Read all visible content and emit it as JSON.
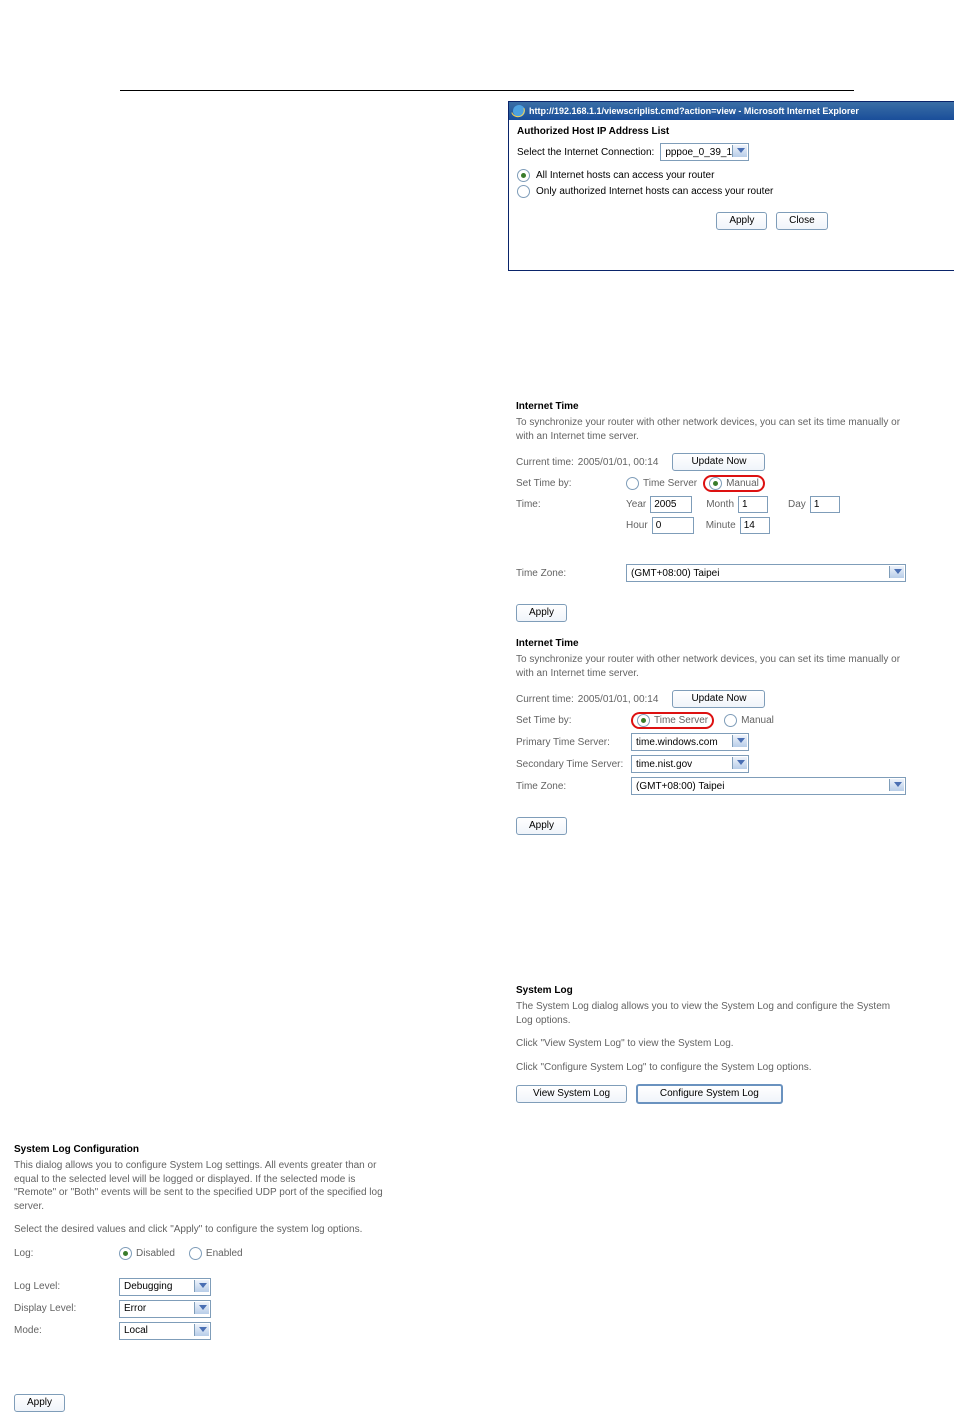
{
  "ie": {
    "title": "http://192.168.1.1/viewscriplist.cmd?action=view - Microsoft Internet Explorer",
    "heading": "Authorized Host IP Address List",
    "select_label": "Select the Internet Connection:",
    "select_value": "pppoe_0_39_1",
    "opt_all": "All Internet hosts can access your router",
    "opt_auth": "Only authorized Internet hosts can access your router",
    "apply": "Apply",
    "close": "Close"
  },
  "time1": {
    "heading": "Internet Time",
    "desc": "To synchronize your router with other network devices, you can set its time manually or with an Internet time server.",
    "cur_lbl": "Current time:",
    "cur_val": "2005/01/01, 00:14",
    "update": "Update Now",
    "set_lbl": "Set Time by:",
    "opt_server": "Time Server",
    "opt_manual": "Manual",
    "time_lbl": "Time:",
    "y_lbl": "Year",
    "y_val": "2005",
    "m_lbl": "Month",
    "m_val": "1",
    "d_lbl": "Day",
    "d_val": "1",
    "h_lbl": "Hour",
    "h_val": "0",
    "mi_lbl": "Minute",
    "mi_val": "14",
    "tz_lbl": "Time Zone:",
    "tz_val": "(GMT+08:00) Taipei",
    "apply": "Apply"
  },
  "time2": {
    "heading": "Internet Time",
    "desc": "To synchronize your router with other network devices, you can set its time manually or with an Internet time server.",
    "cur_lbl": "Current time:",
    "cur_val": "2005/01/01, 00:14",
    "update": "Update Now",
    "set_lbl": "Set Time by:",
    "opt_server": "Time Server",
    "opt_manual": "Manual",
    "pts_lbl": "Primary Time Server:",
    "pts_val": "time.windows.com",
    "sts_lbl": "Secondary Time Server:",
    "sts_val": "time.nist.gov",
    "tz_lbl": "Time Zone:",
    "tz_val": "(GMT+08:00) Taipei",
    "apply": "Apply"
  },
  "syslog": {
    "heading": "System Log",
    "desc": "The System Log dialog allows you to view the System Log and configure the System Log options.",
    "line1": "Click \"View System Log\" to view the System Log.",
    "line2": "Click \"Configure System Log\" to configure the System Log options.",
    "btn_view": "View System Log",
    "btn_conf": "Configure System Log"
  },
  "syscfg": {
    "heading": "System Log Configuration",
    "desc": "This dialog allows you to configure System Log settings. All events greater than or equal to the selected level will be logged or displayed. If the selected mode is \"Remote\" or \"Both\" events will be sent to the specified UDP port of the specified log server.",
    "instr": "Select the desired values and click \"Apply\" to configure the system log options.",
    "log_lbl": "Log:",
    "dis": "Disabled",
    "en": "Enabled",
    "ll_lbl": "Log Level:",
    "ll_val": "Debugging",
    "dl_lbl": "Display Level:",
    "dl_val": "Error",
    "mode_lbl": "Mode:",
    "mode_val": "Local",
    "apply": "Apply"
  }
}
